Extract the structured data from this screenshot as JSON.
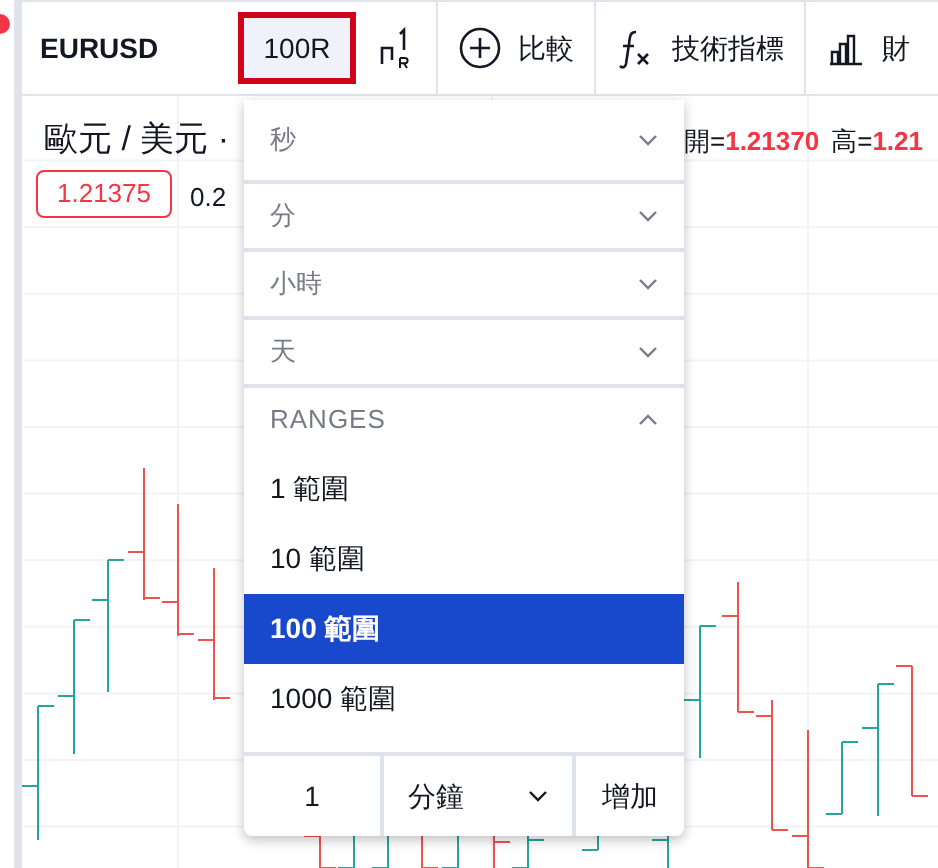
{
  "toolbar": {
    "symbol": "EURUSD",
    "interval_button": {
      "label": "100R",
      "selected": true
    },
    "buttons": [
      {
        "kind": "bar_type"
      },
      {
        "kind": "compare",
        "label": "比較"
      },
      {
        "kind": "indicators",
        "label": "技術指標"
      },
      {
        "kind": "financials",
        "label": "財"
      }
    ]
  },
  "legend": {
    "title": "歐元 / 美元 ·",
    "ohlc": [
      {
        "label": "開=",
        "value": "1.21370"
      },
      {
        "label": "高=",
        "value": "1.21"
      }
    ],
    "price": "1.21375",
    "change": "0.2"
  },
  "interval_menu": {
    "groups": [
      {
        "label": "秒",
        "expanded": false
      },
      {
        "label": "分",
        "expanded": false
      },
      {
        "label": "小時",
        "expanded": false
      },
      {
        "label": "天",
        "expanded": false
      },
      {
        "label": "RANGES",
        "expanded": true,
        "items": [
          {
            "label": "1 範圍",
            "selected": false
          },
          {
            "label": "10 範圍",
            "selected": false
          },
          {
            "label": "100 範圍",
            "selected": true
          },
          {
            "label": "1000 範圍",
            "selected": false
          }
        ]
      }
    ],
    "custom": {
      "value": "1",
      "unit": "分鐘",
      "add_button": "增加"
    }
  }
}
